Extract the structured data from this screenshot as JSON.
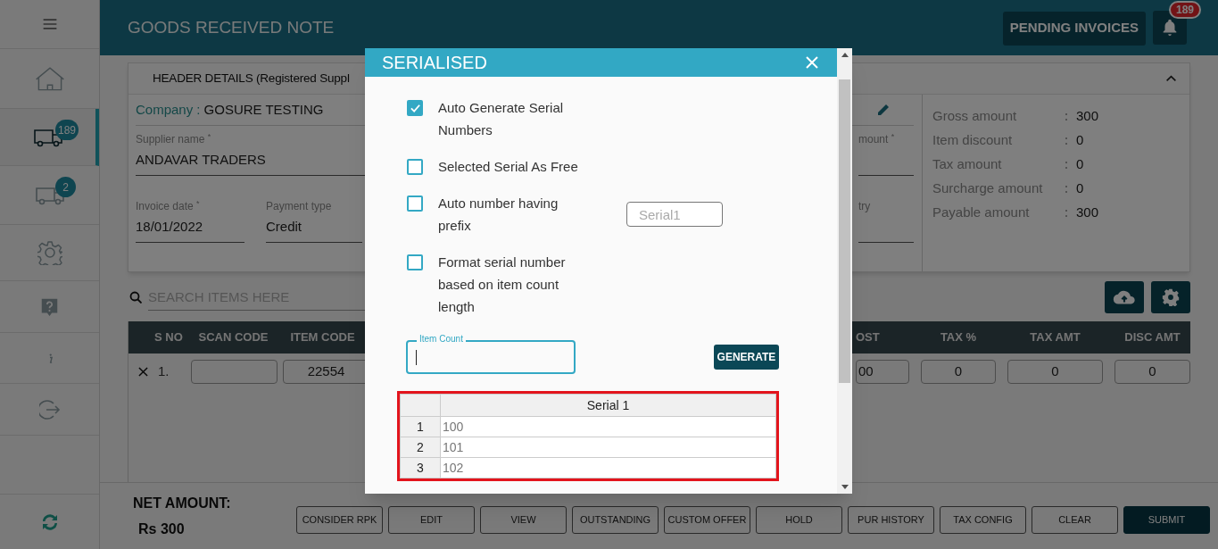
{
  "sidebar": {
    "items": [
      {
        "selected": false
      },
      {
        "selected": false
      },
      {
        "selected": true,
        "badge": "189"
      },
      {
        "selected": false,
        "badge": "2"
      },
      {
        "selected": false
      },
      {
        "selected": false
      },
      {
        "selected": false
      },
      {
        "selected": false
      }
    ]
  },
  "header": {
    "title": "GOODS RECEIVED NOTE",
    "pending_button": "PENDING INVOICES",
    "notification_badge": "189"
  },
  "header_details": {
    "title": "HEADER DETAILS (Registered Suppl",
    "company_label": "Company :",
    "company_value": "GOSURE TESTING",
    "fields": [
      {
        "label": "Supplier name $^{*}$",
        "value": "ANDAVAR TRADERS"
      },
      {
        "label": "mount $^{*}$"
      },
      {
        "label": "Invoice date $^{*}$",
        "value": "18/01/2022"
      },
      {
        "label": "Payment type",
        "value": "Credit"
      },
      {
        "label": "try"
      }
    ],
    "summary": [
      {
        "label": "Gross amount",
        "value": "300"
      },
      {
        "label": "Item discount",
        "value": "0"
      },
      {
        "label": "Tax amount",
        "value": "0"
      },
      {
        "label": "Surcharge amount",
        "value": "0"
      },
      {
        "label": "Payable amount",
        "value": "300"
      }
    ]
  },
  "search": {
    "placeholder": "SEARCH ITEMS HERE"
  },
  "items_table": {
    "columns": [
      "S NO",
      "SCAN CODE",
      "ITEM CODE",
      "OST",
      "TAX %",
      "TAX AMT",
      "DISC AMT"
    ],
    "rows": [
      {
        "s_no": "1.",
        "item_code": "22554",
        "column_4": "00",
        "tax_percent": "0",
        "tax_amt": "0",
        "disc_amt": "0"
      }
    ]
  },
  "footer": {
    "net_amount_label": "NET AMOUNT:",
    "net_amount": "Rs 300",
    "buttons": [
      {
        "label": "CONSIDER RPK",
        "primary": false
      },
      {
        "label": "EDIT",
        "primary": false
      },
      {
        "label": "VIEW",
        "primary": false
      },
      {
        "label": "OUTSTANDING",
        "primary": false
      },
      {
        "label": "CUSTOM OFFER",
        "primary": false
      },
      {
        "label": "HOLD",
        "primary": false
      },
      {
        "label": "PUR HISTORY",
        "primary": false
      },
      {
        "label": "TAX CONFIG",
        "primary": false
      },
      {
        "label": "CLEAR",
        "primary": false
      },
      {
        "label": "SUBMIT",
        "primary": true
      }
    ]
  },
  "modal": {
    "title": "SERIALISED",
    "options": [
      {
        "label": "Auto Generate Serial Numbers",
        "checked": true
      },
      {
        "label": "Selected Serial As Free",
        "checked": false
      },
      {
        "label": "Auto number having prefix",
        "checked": false,
        "prefix_field": {
          "placeholder": "Serial1"
        }
      },
      {
        "label": "Format serial number based on item count length",
        "checked": false
      }
    ],
    "item_count": {
      "label": "Item Count",
      "focused": true
    },
    "generate_button": "GENERATE",
    "serial_table": {
      "columns": [
        "Serial 1"
      ],
      "rows": [
        {
          "index": "1",
          "value": "100"
        },
        {
          "index": "2",
          "value": "101"
        },
        {
          "index": "3",
          "value": "102"
        }
      ]
    }
  }
}
